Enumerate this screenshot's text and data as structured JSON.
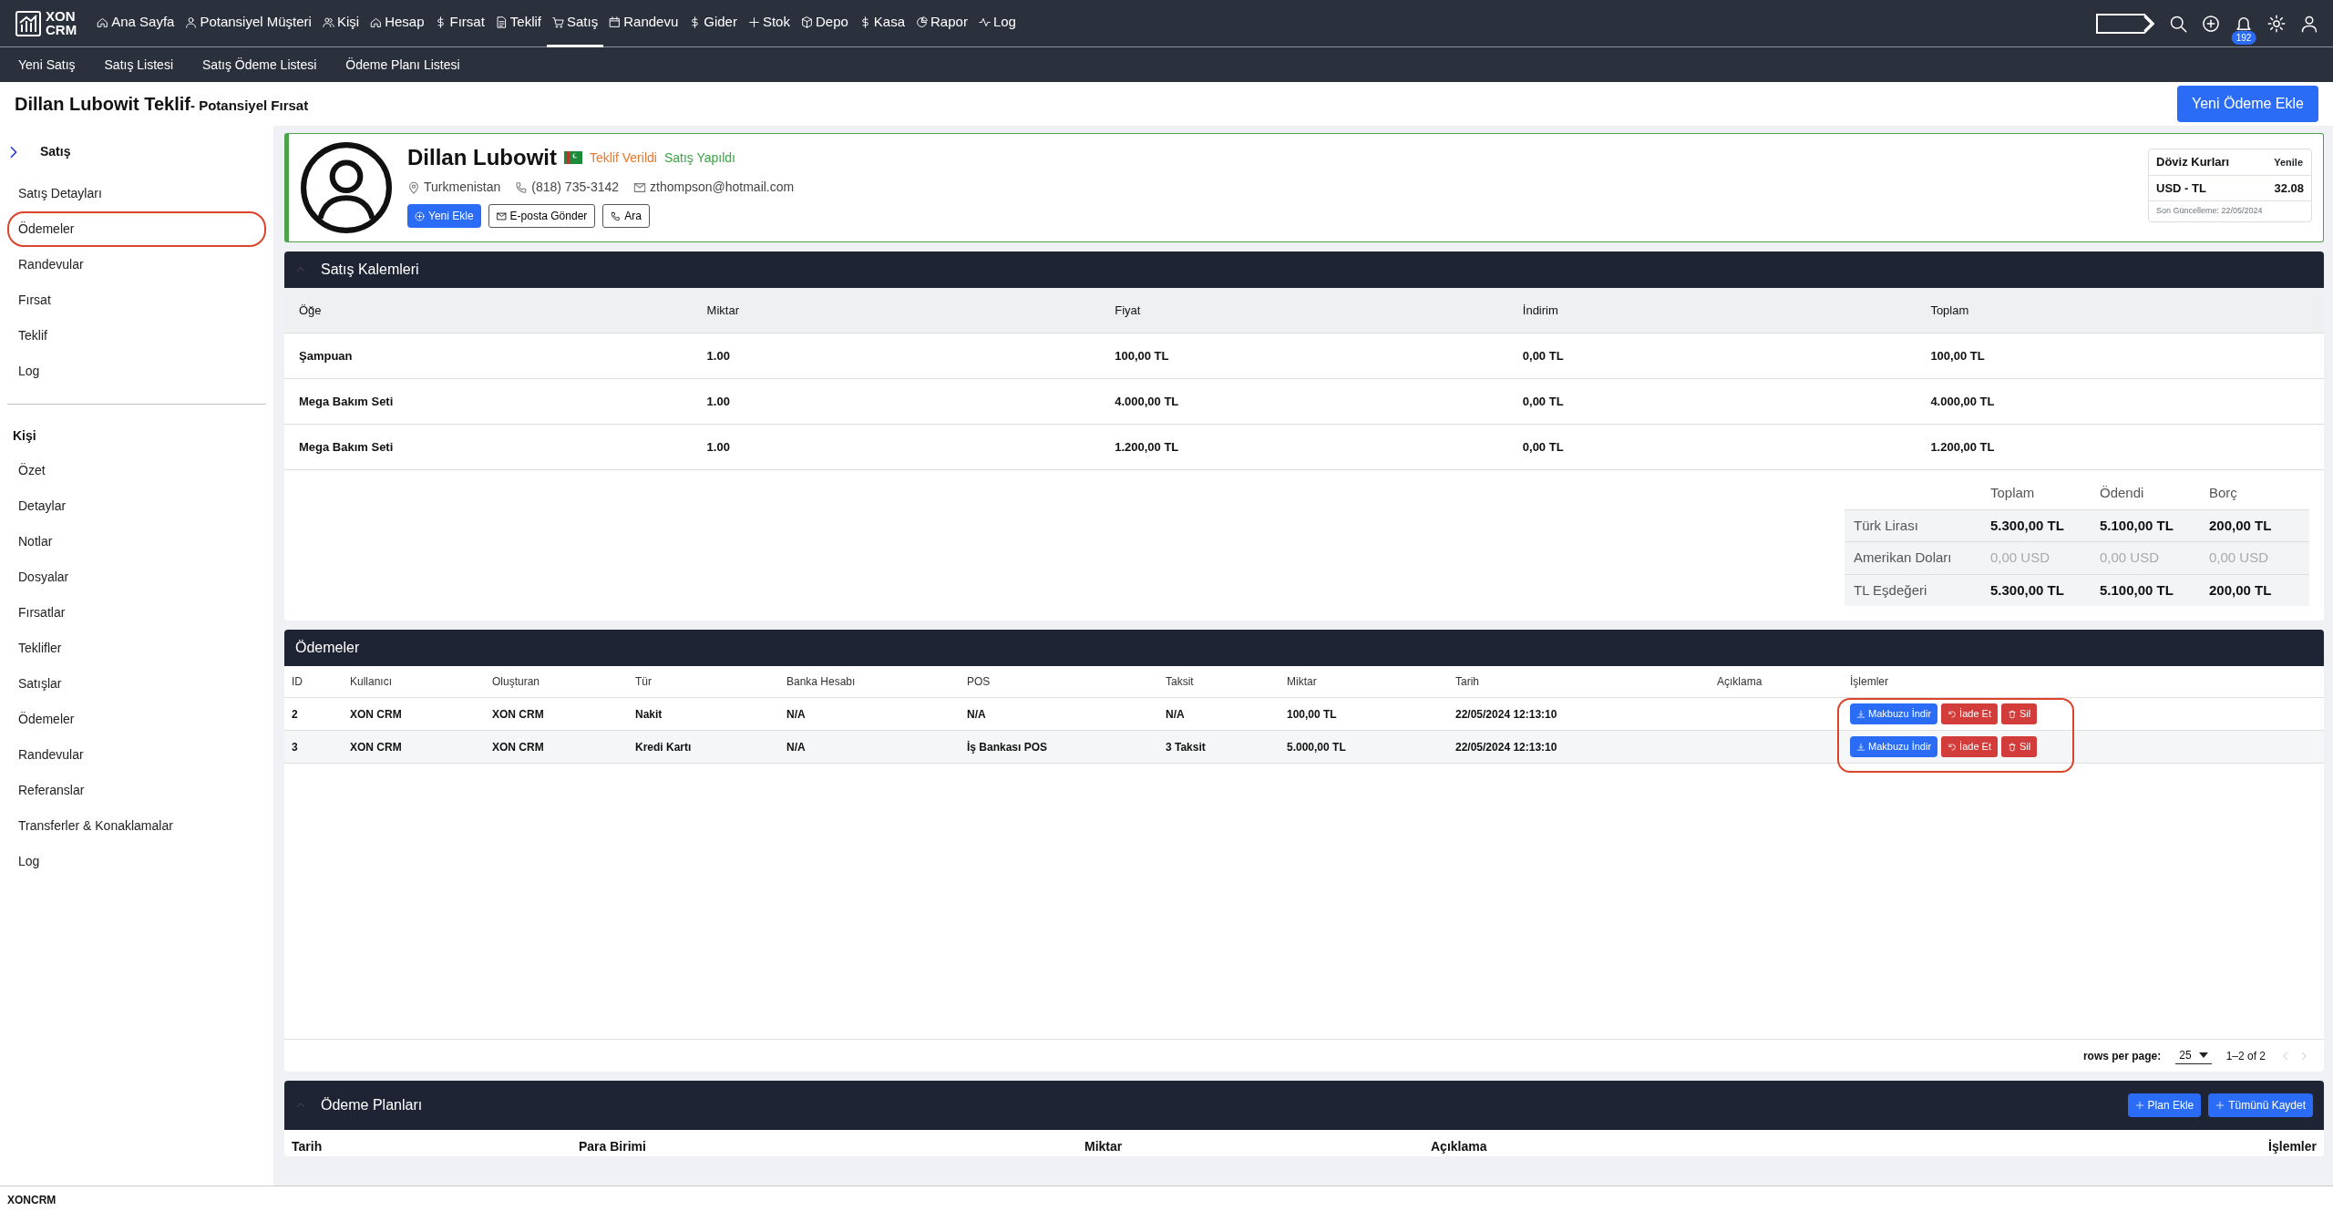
{
  "brand": {
    "line1": "XON",
    "line2": "CRM"
  },
  "nav": [
    {
      "label": "Ana Sayfa",
      "selected": false
    },
    {
      "label": "Potansiyel Müşteri",
      "selected": false
    },
    {
      "label": "Kişi",
      "selected": false
    },
    {
      "label": "Hesap",
      "selected": false
    },
    {
      "label": "Fırsat",
      "selected": false
    },
    {
      "label": "Teklif",
      "selected": false
    },
    {
      "label": "Satış",
      "selected": true
    },
    {
      "label": "Randevu",
      "selected": false
    },
    {
      "label": "Gider",
      "selected": false
    },
    {
      "label": "Stok",
      "selected": false
    },
    {
      "label": "Depo",
      "selected": false
    },
    {
      "label": "Kasa",
      "selected": false
    },
    {
      "label": "Rapor",
      "selected": false
    },
    {
      "label": "Log",
      "selected": false
    }
  ],
  "notifications": {
    "count": "192"
  },
  "subnav": [
    "Yeni Satış",
    "Satış Listesi",
    "Satış Ödeme Listesi",
    "Ödeme Planı Listesi"
  ],
  "page_header": {
    "title": "Dillan Lubowit Teklif",
    "subtitle": "- Potansiyel Fırsat",
    "button": "Yeni Ödeme Ekle"
  },
  "sidebar": {
    "sections": [
      {
        "title": "Satış",
        "kind": "collapsible",
        "items": [
          {
            "label": "Satış Detayları",
            "circled": false
          },
          {
            "label": "Ödemeler",
            "circled": true
          },
          {
            "label": "Randevular",
            "circled": false
          },
          {
            "label": "Fırsat",
            "circled": false
          },
          {
            "label": "Teklif",
            "circled": false
          },
          {
            "label": "Log",
            "circled": false
          }
        ]
      },
      {
        "title": "Kişi",
        "kind": "heading",
        "items": [
          {
            "label": "Özet",
            "circled": false
          },
          {
            "label": "Detaylar",
            "circled": false
          },
          {
            "label": "Notlar",
            "circled": false
          },
          {
            "label": "Dosyalar",
            "circled": false
          },
          {
            "label": "Fırsatlar",
            "circled": false
          },
          {
            "label": "Teklifler",
            "circled": false
          },
          {
            "label": "Satışlar",
            "circled": false
          },
          {
            "label": "Ödemeler",
            "circled": false
          },
          {
            "label": "Randevular",
            "circled": false
          },
          {
            "label": "Referanslar",
            "circled": false
          },
          {
            "label": "Transferler & Konaklamalar",
            "circled": false
          },
          {
            "label": "Log",
            "circled": false
          }
        ]
      }
    ]
  },
  "contact": {
    "name": "Dillan Lubowit",
    "badges": [
      {
        "text": "Teklif Verildi",
        "color": "#e8772e"
      },
      {
        "text": "Satış Yapıldı",
        "color": "#3aa346"
      }
    ],
    "country": "Turkmenistan",
    "phone": "(818) 735-3142",
    "email": "zthompson@hotmail.com",
    "buttons": [
      {
        "label": "Yeni Ekle",
        "kind": "primary"
      },
      {
        "label": "E-posta Gönder",
        "kind": "outline"
      },
      {
        "label": "Ara",
        "kind": "outline"
      }
    ]
  },
  "exchange": {
    "title": "Döviz Kurları",
    "refresh": "Yenile",
    "pair": "USD - TL",
    "rate": "32.08",
    "updated": "Son Güncelleme: 22/05/2024"
  },
  "sale_items": {
    "title": "Satış Kalemleri",
    "columns": [
      "Öğe",
      "Miktar",
      "Fiyat",
      "İndirim",
      "Toplam"
    ],
    "rows": [
      [
        "Şampuan",
        "1.00",
        "100,00 TL",
        "0,00 TL",
        "100,00 TL"
      ],
      [
        "Mega Bakım Seti",
        "1.00",
        "4.000,00 TL",
        "0,00 TL",
        "4.000,00 TL"
      ],
      [
        "Mega Bakım Seti",
        "1.00",
        "1.200,00 TL",
        "0,00 TL",
        "1.200,00 TL"
      ]
    ]
  },
  "totals": {
    "columns": [
      "Toplam",
      "Ödendi",
      "Borç"
    ],
    "rows": [
      {
        "label": "Türk Lirası",
        "values": [
          "5.300,00 TL",
          "5.100,00 TL",
          "200,00 TL"
        ],
        "muted": false
      },
      {
        "label": "Amerikan Doları",
        "values": [
          "0,00 USD",
          "0,00 USD",
          "0,00 USD"
        ],
        "muted": true
      },
      {
        "label": "TL Eşdeğeri",
        "values": [
          "5.300,00 TL",
          "5.100,00 TL",
          "200,00 TL"
        ],
        "muted": false
      }
    ]
  },
  "payments": {
    "title": "Ödemeler",
    "columns": [
      "ID",
      "Kullanıcı",
      "Oluşturan",
      "Tür",
      "Banka Hesabı",
      "POS",
      "Taksit",
      "Miktar",
      "Tarih",
      "Açıklama",
      "İşlemler"
    ],
    "rows": [
      {
        "cells": [
          "2",
          "XON CRM",
          "XON CRM",
          "Nakit",
          "N/A",
          "N/A",
          "N/A",
          "100,00 TL",
          "22/05/2024 12:13:10"
        ],
        "actions": [
          "Makbuzu İndir",
          "İade Et",
          "Sil"
        ]
      },
      {
        "cells": [
          "3",
          "XON CRM",
          "XON CRM",
          "Kredi Kartı",
          "N/A",
          "İş Bankası POS",
          "3 Taksit",
          "5.000,00 TL",
          "22/05/2024 12:13:10"
        ],
        "actions": [
          "Makbuzu İndir",
          "İade Et",
          "Sil"
        ]
      }
    ],
    "actions_circled": true
  },
  "pagination": {
    "label": "rows per page:",
    "per_page": "25",
    "range": "1–2 of 2"
  },
  "payment_plans": {
    "title": "Ödeme Planları",
    "buttons": [
      "Plan Ekle",
      "Tümünü Kaydet"
    ],
    "columns": [
      "Tarih",
      "Para Birimi",
      "Miktar",
      "Açıklama",
      "İşlemler"
    ]
  },
  "footer": "XONCRM"
}
